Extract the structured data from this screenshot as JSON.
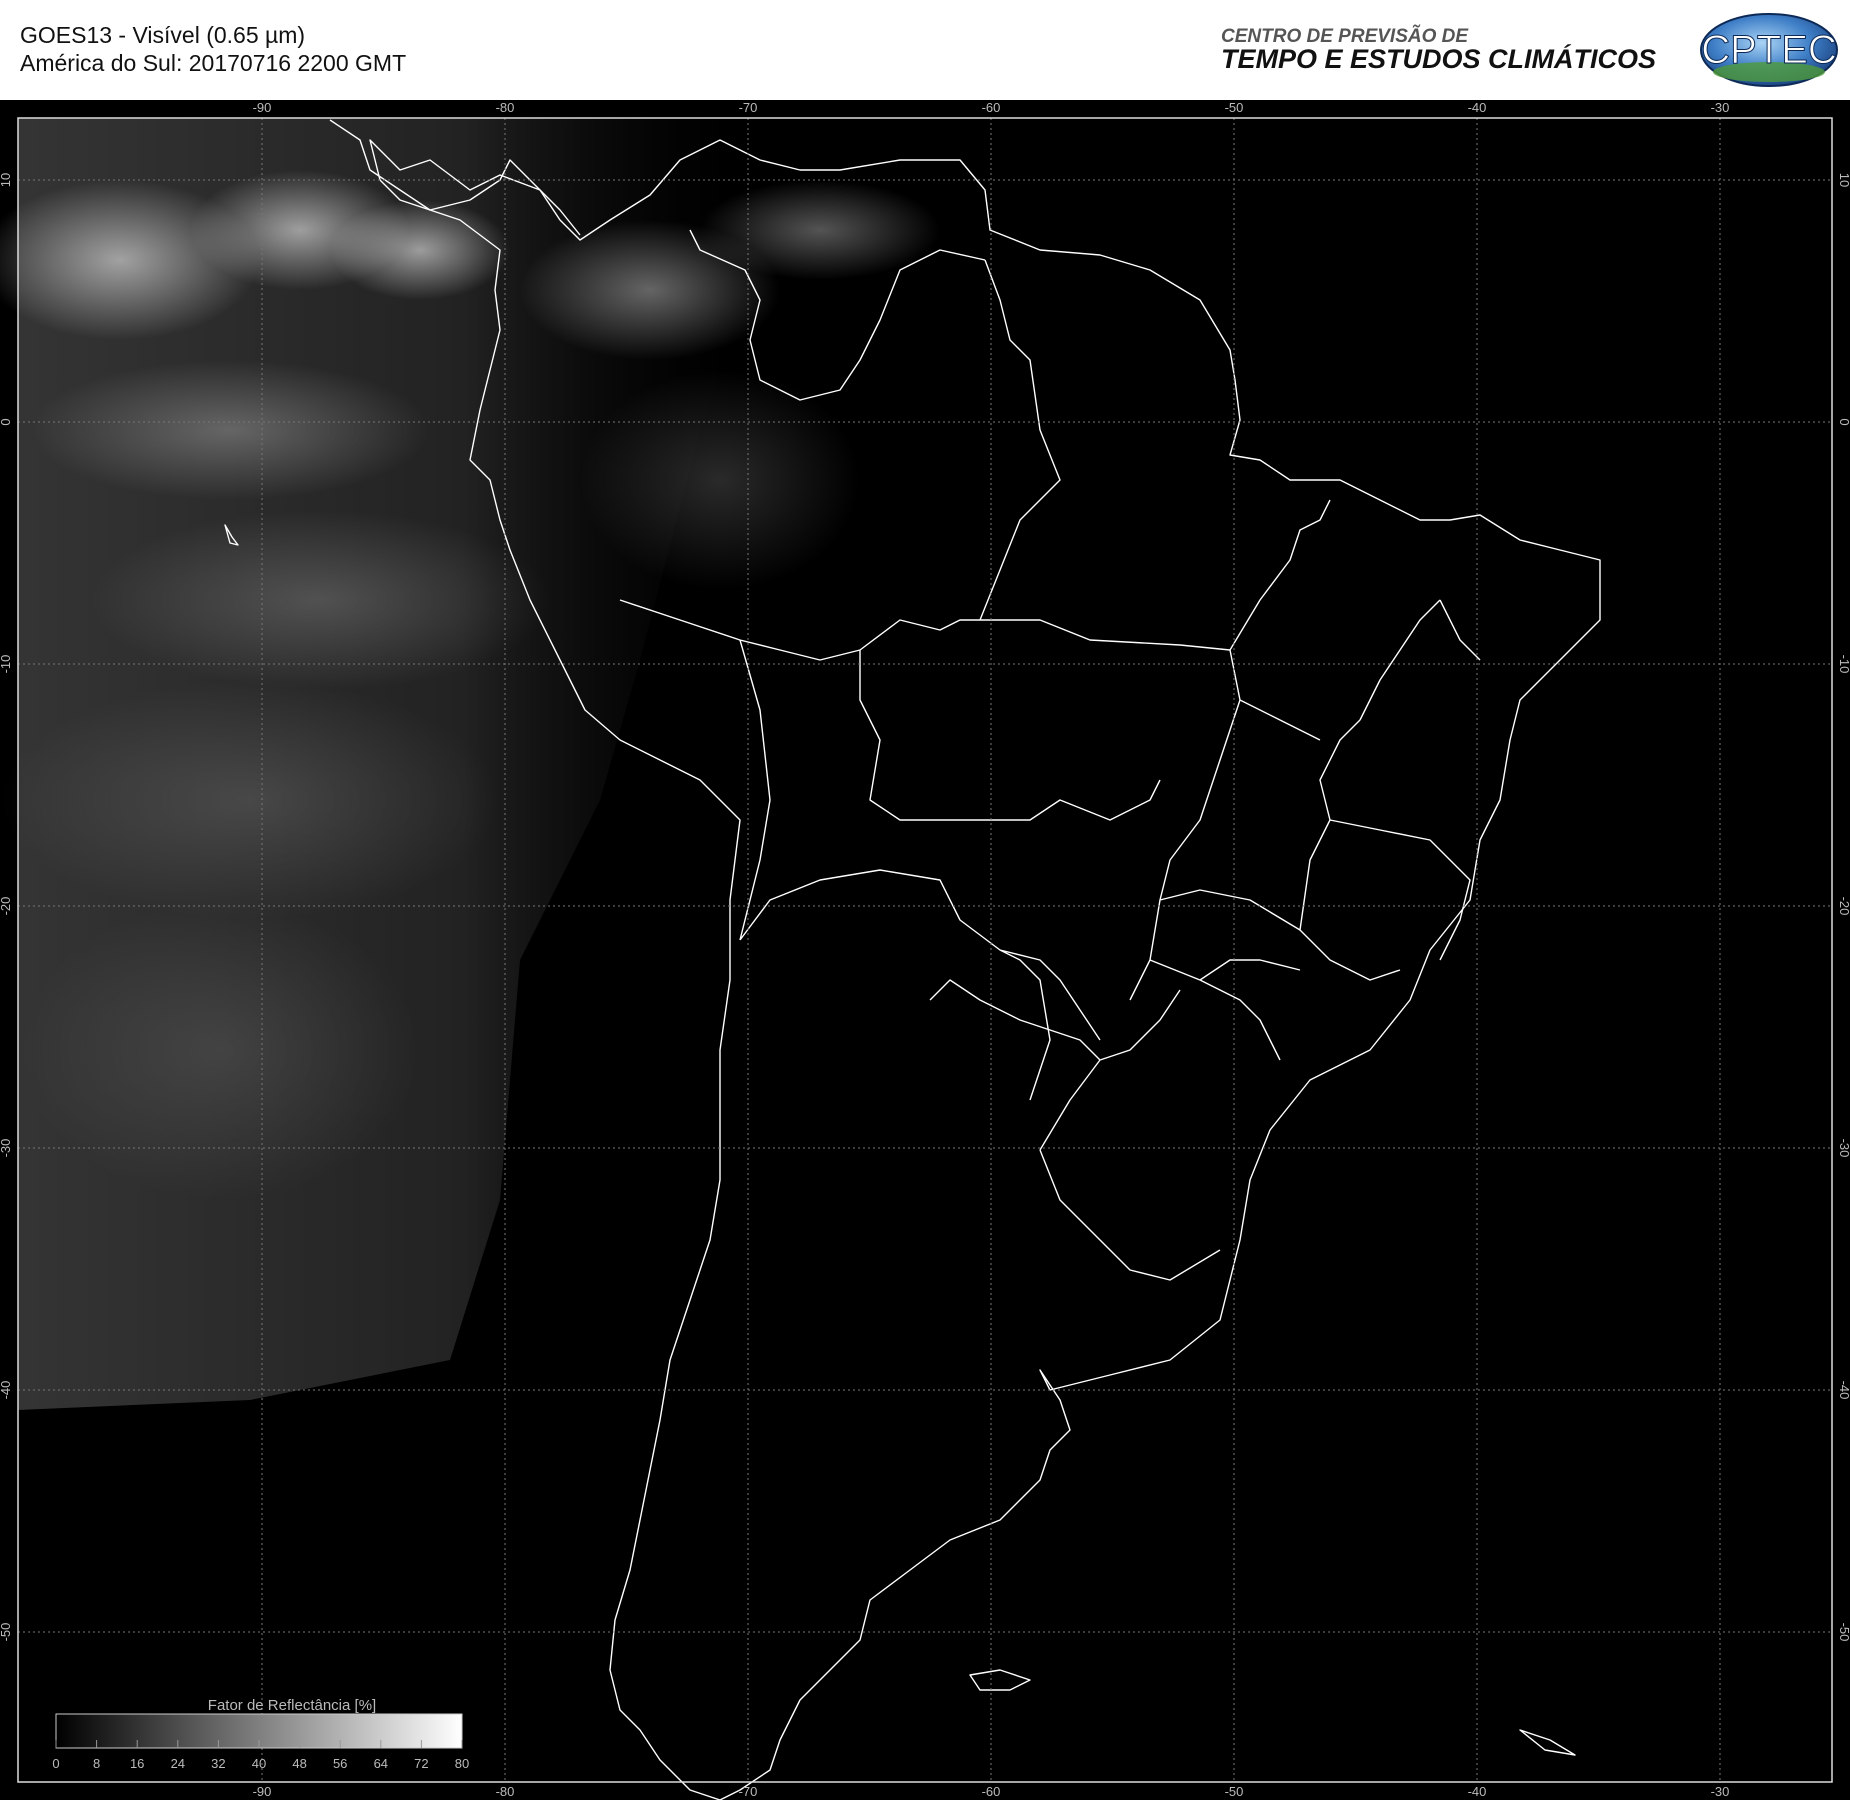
{
  "header": {
    "line1": "GOES13 - Visível (0.65 µm)",
    "line2": "América do Sul: 20170716 2200 GMT"
  },
  "org": {
    "small": "CENTRO DE PREVISÃO DE",
    "big": "TEMPO E ESTUDOS CLIMÁTICOS",
    "logo_text": "CPTEC"
  },
  "map": {
    "lon_labels": [
      "-90",
      "-80",
      "-70",
      "-60",
      "-50",
      "-40",
      "-30"
    ],
    "lat_labels": [
      "10",
      "0",
      "-10",
      "-20",
      "-30",
      "-40",
      "-50"
    ],
    "grid": "dotted",
    "colors": {
      "background": "#000000",
      "coastline": "#ffffff",
      "grid": "#777777"
    }
  },
  "colorbar": {
    "title": "Fator de Reflectância [%]",
    "ticks": [
      "0",
      "8",
      "16",
      "24",
      "32",
      "40",
      "48",
      "56",
      "64",
      "72",
      "80"
    ]
  }
}
